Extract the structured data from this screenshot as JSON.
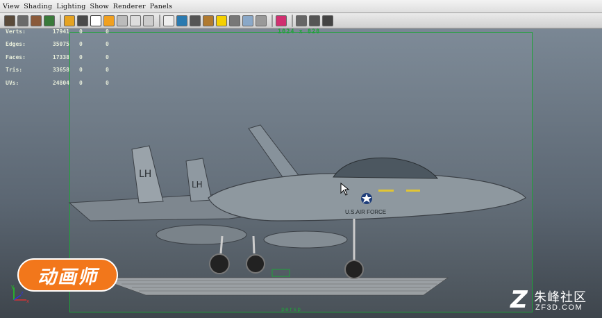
{
  "menu": [
    "View",
    "Shading",
    "Lighting",
    "Show",
    "Renderer",
    "Panels"
  ],
  "toolbar_icons": [
    "camera-select-icon",
    "camera-attributes-icon",
    "bookmark-icon",
    "image-plane-icon",
    "grid-icon",
    "film-gate-icon",
    "resolution-gate-icon",
    "gate-mask-icon",
    "field-chart-icon",
    "safe-action-icon",
    "safe-title-icon",
    "wireframe-icon",
    "smooth-shade-icon",
    "shaded-wireframe-icon",
    "texture-icon",
    "lighting-icon",
    "shadows-icon",
    "xray-icon",
    "isolate-icon",
    "xray-joints-icon",
    "frame-selection-icon",
    "frame-all-icon",
    "high-quality-icon"
  ],
  "hud": {
    "rows": [
      {
        "label": "Verts:",
        "v1": "17941",
        "v2": "0",
        "v3": "0"
      },
      {
        "label": "Edges:",
        "v1": "35075",
        "v2": "0",
        "v3": "0"
      },
      {
        "label": "Faces:",
        "v1": "17338",
        "v2": "0",
        "v3": "0"
      },
      {
        "label": "Tris:",
        "v1": "33658",
        "v2": "0",
        "v3": "0"
      },
      {
        "label": "UVs:",
        "v1": "24804",
        "v2": "0",
        "v3": "0"
      }
    ]
  },
  "viewport": {
    "resolution": "1024 x 828",
    "camera": "persp",
    "aircraft_tail_code": "LH",
    "aircraft_marking": "U.S.AIR FORCE"
  },
  "watermarks": {
    "left": "动画师",
    "right_cn": "朱峰社区",
    "right_en": "ZF3D.COM",
    "right_logo": "Z"
  },
  "axis": {
    "x": "x",
    "y": "y",
    "z": "z"
  }
}
